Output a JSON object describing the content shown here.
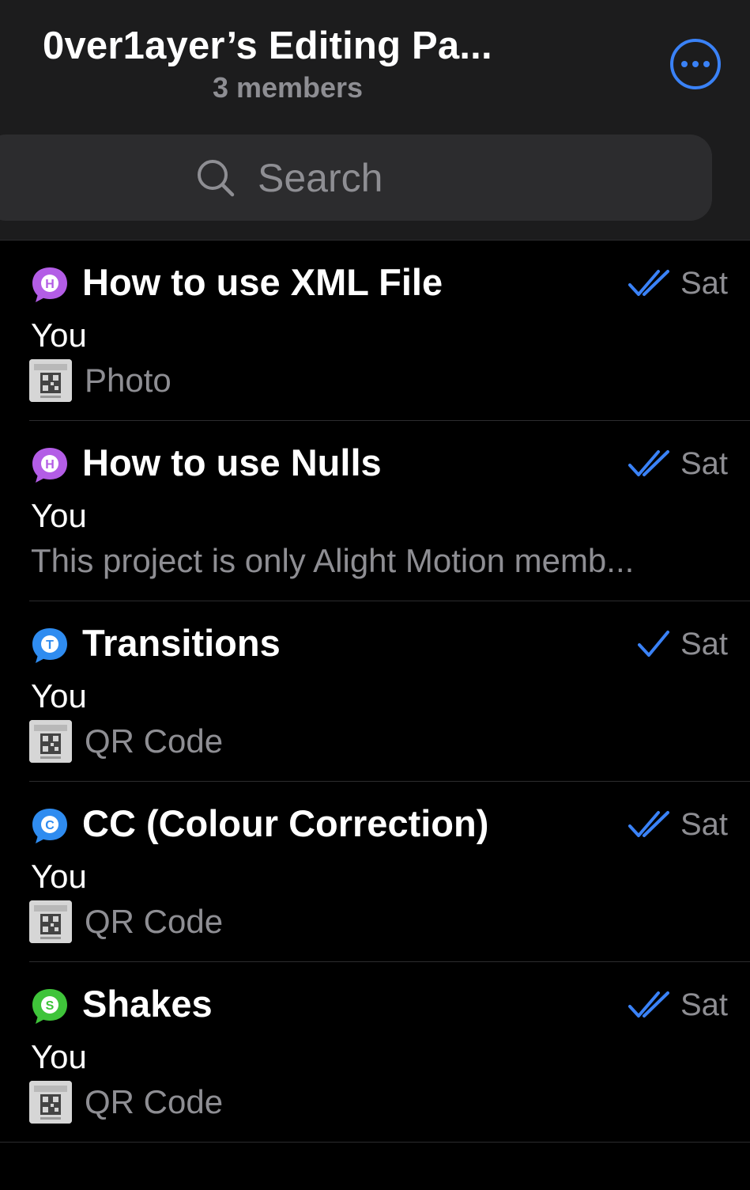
{
  "header": {
    "title": "0ver1ayer’s Editing Pa...",
    "subtitle": "3 members",
    "more_icon": "ellipsis-circle-icon"
  },
  "search": {
    "placeholder": "Search",
    "icon": "search-icon"
  },
  "colors": {
    "accent": "#3a82f7",
    "purple": "#b35de6",
    "blue": "#2f8cf0",
    "green": "#3fc43a",
    "secondary_text": "#8e8e93"
  },
  "topics": [
    {
      "icon_letter": "H",
      "icon_color": "purple",
      "title": "How to use XML File",
      "status": "read",
      "time": "Sat",
      "sender": "You",
      "preview": "Photo",
      "has_thumb": true
    },
    {
      "icon_letter": "H",
      "icon_color": "purple",
      "title": "How to use Nulls",
      "status": "read",
      "time": "Sat",
      "sender": "You",
      "preview": "This project is only Alight Motion memb...",
      "has_thumb": false
    },
    {
      "icon_letter": "T",
      "icon_color": "blue",
      "title": "Transitions",
      "status": "sent",
      "time": "Sat",
      "sender": "You",
      "preview": "QR Code",
      "has_thumb": true
    },
    {
      "icon_letter": "C",
      "icon_color": "blue",
      "title": "CC (Colour Correction)",
      "status": "read",
      "time": "Sat",
      "sender": "You",
      "preview": "QR Code",
      "has_thumb": true
    },
    {
      "icon_letter": "S",
      "icon_color": "green",
      "title": "Shakes",
      "status": "read",
      "time": "Sat",
      "sender": "You",
      "preview": "QR Code",
      "has_thumb": true
    }
  ]
}
